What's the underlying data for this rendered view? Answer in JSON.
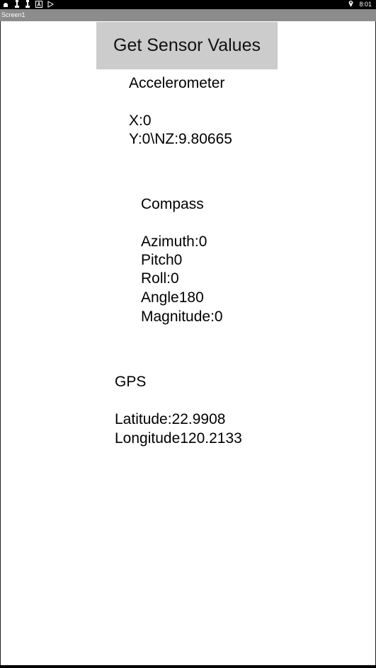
{
  "status_bar": {
    "time": "8:01",
    "icons": [
      "notification-icon",
      "chess-piece-icon",
      "chess-piece-icon",
      "a-box-icon",
      "play-store-icon"
    ],
    "location_icon": "location-pin-icon"
  },
  "title_bar": {
    "title": "Screen1"
  },
  "button": {
    "label": "Get Sensor Values"
  },
  "accelerometer": {
    "heading": "Accelerometer",
    "x": "X:0",
    "y_z": "Y:0\\NZ:9.80665"
  },
  "compass": {
    "heading": "Compass",
    "azimuth": "Azimuth:0",
    "pitch": "Pitch0",
    "roll": "Roll:0",
    "angle": "Angle180",
    "magnitude": "Magnitude:0"
  },
  "gps": {
    "heading": "GPS",
    "latitude": "Latitude:22.9908",
    "longitude": "Longitude120.2133"
  }
}
